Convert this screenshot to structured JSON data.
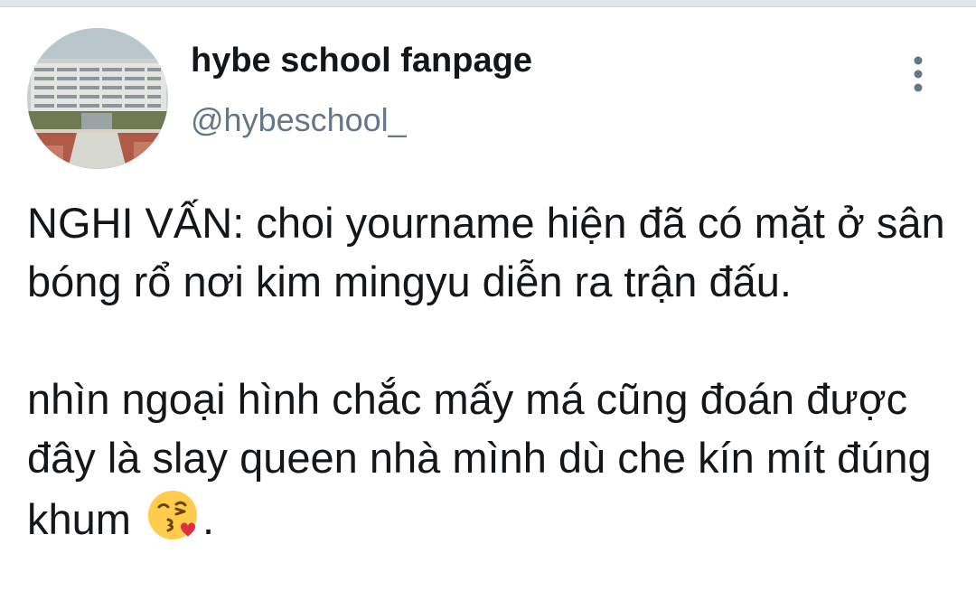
{
  "account": {
    "display_name": "hybe school fanpage",
    "handle": "@hybeschool_",
    "avatar_icon": "school-building-avatar"
  },
  "menu": {
    "icon": "more-vertical-icon"
  },
  "tweet": {
    "paragraph_1": "NGHI VẤN: choi yourname hiện đã có mặt ở sân bóng rổ nơi kim mingyu diễn ra trận đấu.",
    "paragraph_2_text": "nhìn ngoại hình chắc mấy má cũng đoán được đây là slay queen nhà mình dù che kín mít đúng khum ",
    "paragraph_2_emoji": "face-blowing-a-kiss-emoji",
    "paragraph_2_end": "."
  },
  "colors": {
    "name": "#14171a",
    "handle": "#657786",
    "icon": "#657786",
    "divider": "#e3e6e8"
  }
}
